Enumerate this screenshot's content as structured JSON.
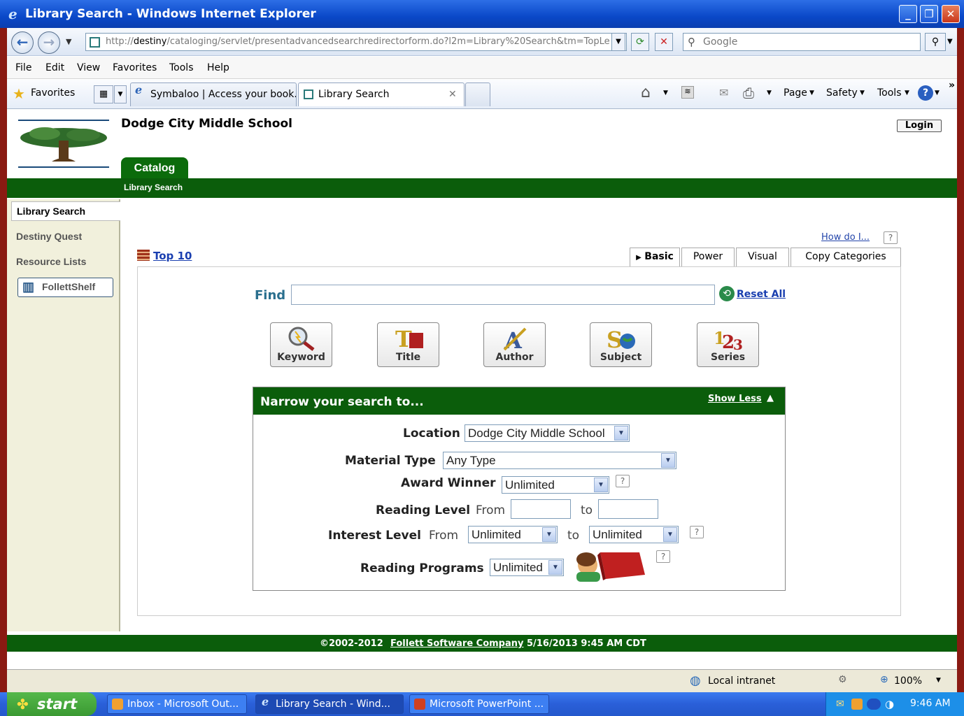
{
  "window": {
    "title": "Library Search - Windows Internet Explorer"
  },
  "address": {
    "url_prefix": "http://",
    "url_host": "destiny",
    "url_rest": "/cataloging/servlet/presentadvancedsearchredirectorform.do?l2m=Library%20Search&tm=TopLe",
    "search_placeholder": "Google"
  },
  "menu": [
    "File",
    "Edit",
    "View",
    "Favorites",
    "Tools",
    "Help"
  ],
  "favbar": {
    "favorites_label": "Favorites",
    "tabs": [
      {
        "label": "Symbaloo | Access your book..."
      },
      {
        "label": "Library Search"
      }
    ],
    "commands": [
      "Page",
      "Safety",
      "Tools"
    ]
  },
  "page": {
    "school": "Dodge City Middle School",
    "login": "Login",
    "catalog_tab": "Catalog",
    "subnav": "Library Search",
    "sidebar": [
      "Library Search",
      "Destiny Quest",
      "Resource Lists",
      "FollettShelf"
    ],
    "how_do_i": "How do I...",
    "help_q": "?",
    "top10": "Top 10",
    "search_tabs": [
      "Basic",
      "Power",
      "Visual",
      "Copy Categories"
    ],
    "find_label": "Find",
    "find_value": "",
    "reset_all": "Reset All",
    "search_buttons": [
      "Keyword",
      "Title",
      "Author",
      "Subject",
      "Series"
    ],
    "narrow": {
      "heading": "Narrow your search to...",
      "show_less": "Show Less",
      "location_label": "Location",
      "location_value": "Dodge City Middle School",
      "material_label": "Material Type",
      "material_value": "Any Type",
      "award_label": "Award Winner",
      "award_value": "Unlimited",
      "reading_level_label": "Reading Level",
      "from": "From",
      "to": "to",
      "interest_label": "Interest Level",
      "interest_from_value": "Unlimited",
      "interest_to_value": "Unlimited",
      "programs_label": "Reading Programs",
      "programs_value": "Unlimited"
    },
    "footer": {
      "copyright": "©2002-2012",
      "company": "Follett Software Company",
      "timestamp": "5/16/2013 9:45 AM CDT"
    }
  },
  "status": {
    "zone": "Local intranet",
    "zoom": "100%"
  },
  "taskbar": {
    "start": "start",
    "tasks": [
      "Inbox - Microsoft Out...",
      "Library Search - Wind...",
      "Microsoft PowerPoint ..."
    ],
    "time": "9:46 AM"
  }
}
